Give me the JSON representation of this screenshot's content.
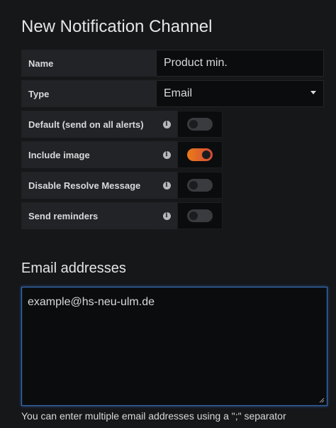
{
  "page": {
    "title": "New Notification Channel"
  },
  "form": {
    "name": {
      "label": "Name",
      "value": "Product min."
    },
    "type": {
      "label": "Type",
      "value": "Email"
    },
    "toggles": [
      {
        "label": "Default (send on all alerts)",
        "enabled": false,
        "info_icon": "info-icon"
      },
      {
        "label": "Include image",
        "enabled": true,
        "info_icon": "info-icon"
      },
      {
        "label": "Disable Resolve Message",
        "enabled": false,
        "info_icon": "info-icon"
      },
      {
        "label": "Send reminders",
        "enabled": false,
        "info_icon": "info-icon"
      }
    ]
  },
  "email_section": {
    "title": "Email addresses",
    "value": "example@hs-neu-ulm.de",
    "hint": "You can enter multiple email addresses using a \";\" separator"
  },
  "colors": {
    "background": "#161719",
    "label_bg": "#222327",
    "input_bg": "#0b0c0e",
    "toggle_on_start": "#eb7b18",
    "toggle_on_end": "#d44a3a",
    "focus_border": "#3a6fb0"
  }
}
